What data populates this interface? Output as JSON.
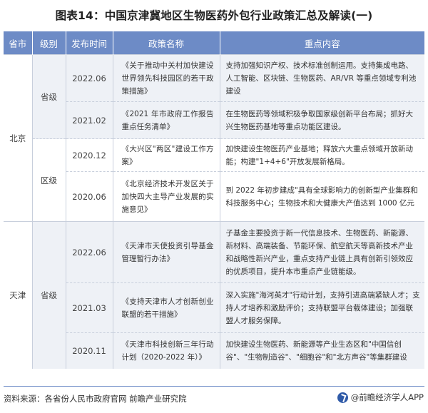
{
  "title": "图表14：中国京津冀地区生物医药外包行业政策汇总及解读(一)",
  "headers": [
    "省市",
    "级别",
    "发布时间",
    "政策名称",
    "重点内容"
  ],
  "rows": [
    {
      "date": "2022.06",
      "name": "《关于推动中关村加快建设世界领先科技园区的若干政策措施》",
      "content": "支持加强知识产权、技术标准创制运用。支持集成电路、人工智能、区块链、生物医药、AR/VR 等重点领域专利池建设"
    },
    {
      "date": "2021.02",
      "name": "《2021 年市政府工作报告重点任务清单》",
      "content": "在生物医药等领域积极争取国家级创新平台布局；抓好大兴生物医药基地等重点功能区建设。"
    },
    {
      "date": "2020.12",
      "name": "《大兴区\"两区\"建设工作方案》",
      "content": "加快建设生物医药产业基地；释放六大重点领域开放新动能；构建\"1+4+6\"开放发展新格局。"
    },
    {
      "date": "2020.06",
      "name": "《北京经济技术开发区关于加快四大主导产业发展的实施意见》",
      "content": "到 2022 年初步建成\"具有全球影响力的创新型产业集群和科技服务中心；生物技术和大健康大产值达到 1000 亿元"
    },
    {
      "date": "2022.06",
      "name": "《天津市天使投资引导基金管理暂行办法》",
      "content": "子基金主要投资于新一代信息技术、生物医药、新能源、新材料、高端装备、节能环保、航空航天等高新技术产业和战略性新兴产业，重点支持产业链上具有创新引领效应的优质项目，提升本市重点产业链能级。"
    },
    {
      "date": "2021.03",
      "name": "《支持天津市人才创新创业联盟的若干措施》",
      "content": "深入实施\"海河英才\"行动计划，支持引进高端紧缺人才；支持人才培养和激励评价；支持联盟平台载体建设；加强联盟人才服务保障。"
    },
    {
      "date": "2020.11",
      "name": "《天津市科技创新三年行动计划（2020-2022 年）》",
      "content": "加快建设生物医药、新能源等产业生态区和\"中国信创谷\"、\"生物制造谷\"、\"细胞谷\"和\"北方声谷\"等集群建设"
    }
  ],
  "groups": [
    {
      "province": "北京",
      "levels": [
        "省级",
        "区级"
      ]
    },
    {
      "province": "天津",
      "levels": [
        "省级"
      ]
    }
  ],
  "source": "资料来源：各省份人民市政府官网 前瞻产业研究院",
  "brand": "@前瞻经济学人APP",
  "colors": {
    "header_bg": "#6d8bc6",
    "shade": "#eef1f6"
  }
}
